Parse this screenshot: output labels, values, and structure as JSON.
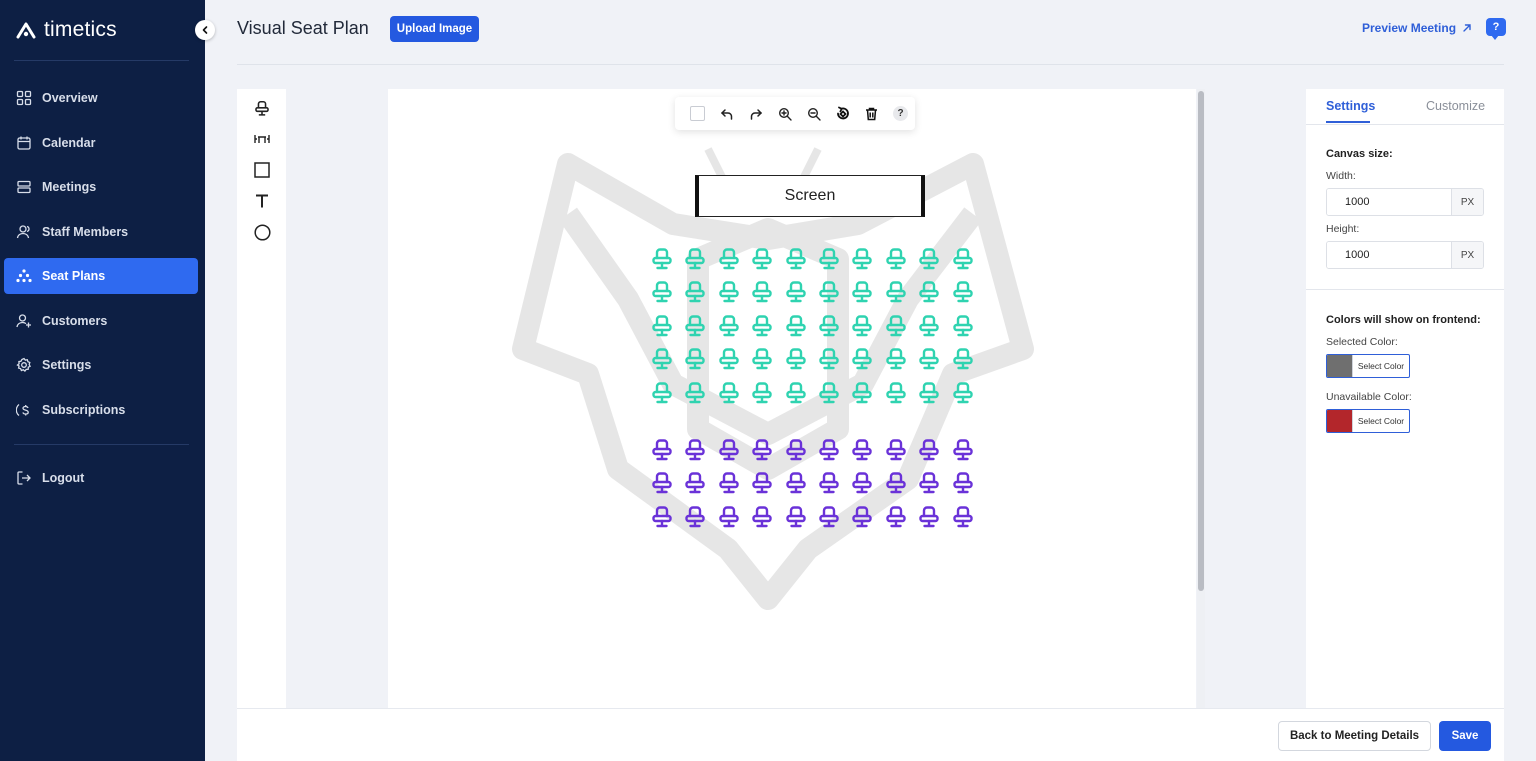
{
  "app": {
    "brand": "timetics",
    "page_title": "Visual Seat Plan"
  },
  "sidebar": {
    "items": [
      {
        "label": "Overview",
        "icon": "grid-icon",
        "active": false
      },
      {
        "label": "Calendar",
        "icon": "calendar-icon",
        "active": false
      },
      {
        "label": "Meetings",
        "icon": "stack-icon",
        "active": false
      },
      {
        "label": "Staff Members",
        "icon": "user-icon",
        "active": false
      },
      {
        "label": "Seat Plans",
        "icon": "seat-plan-icon",
        "active": true
      },
      {
        "label": "Customers",
        "icon": "user-add-icon",
        "active": false
      },
      {
        "label": "Settings",
        "icon": "gear-icon",
        "active": false
      },
      {
        "label": "Subscriptions",
        "icon": "dollar-icon",
        "active": false
      }
    ],
    "logout_label": "Logout"
  },
  "header": {
    "upload_label": "Upload Image",
    "preview_label": "Preview Meeting",
    "help_label": "?"
  },
  "tools": [
    "seat-tool-icon",
    "table-tool-icon",
    "rectangle-tool-icon",
    "text-tool-icon",
    "circle-tool-icon"
  ],
  "canvas_toolbar": {
    "buttons": [
      "select-all-checkbox",
      "undo-icon",
      "redo-icon",
      "zoom-in-icon",
      "zoom-out-icon",
      "rotate-icon",
      "trash-icon",
      "help-icon"
    ],
    "help_label": "?"
  },
  "canvas": {
    "screen_label": "Screen",
    "seat_grid": {
      "columns": 10,
      "groups": [
        {
          "rows": 5,
          "color": "#2fd3b0"
        },
        {
          "rows": 3,
          "color": "#6a32d8"
        }
      ]
    }
  },
  "panel": {
    "tabs": [
      "Settings",
      "Customize"
    ],
    "active_tab": "Settings",
    "canvas_size_heading": "Canvas size:",
    "width_label": "Width:",
    "width_value": "1000",
    "height_label": "Height:",
    "height_value": "1000",
    "unit": "PX",
    "colors_heading": "Colors will show on frontend:",
    "selected_color_label": "Selected Color:",
    "selected_color": "#6f6f6f",
    "unavailable_color_label": "Unavailable Color:",
    "unavailable_color": "#b3262b",
    "select_color_label": "Select Color"
  },
  "footer": {
    "back_label": "Back to Meeting Details",
    "save_label": "Save"
  },
  "colors": {
    "sidebar_bg": "#0d1f44",
    "accent": "#2f6af0",
    "primary_button": "#2459e0"
  }
}
